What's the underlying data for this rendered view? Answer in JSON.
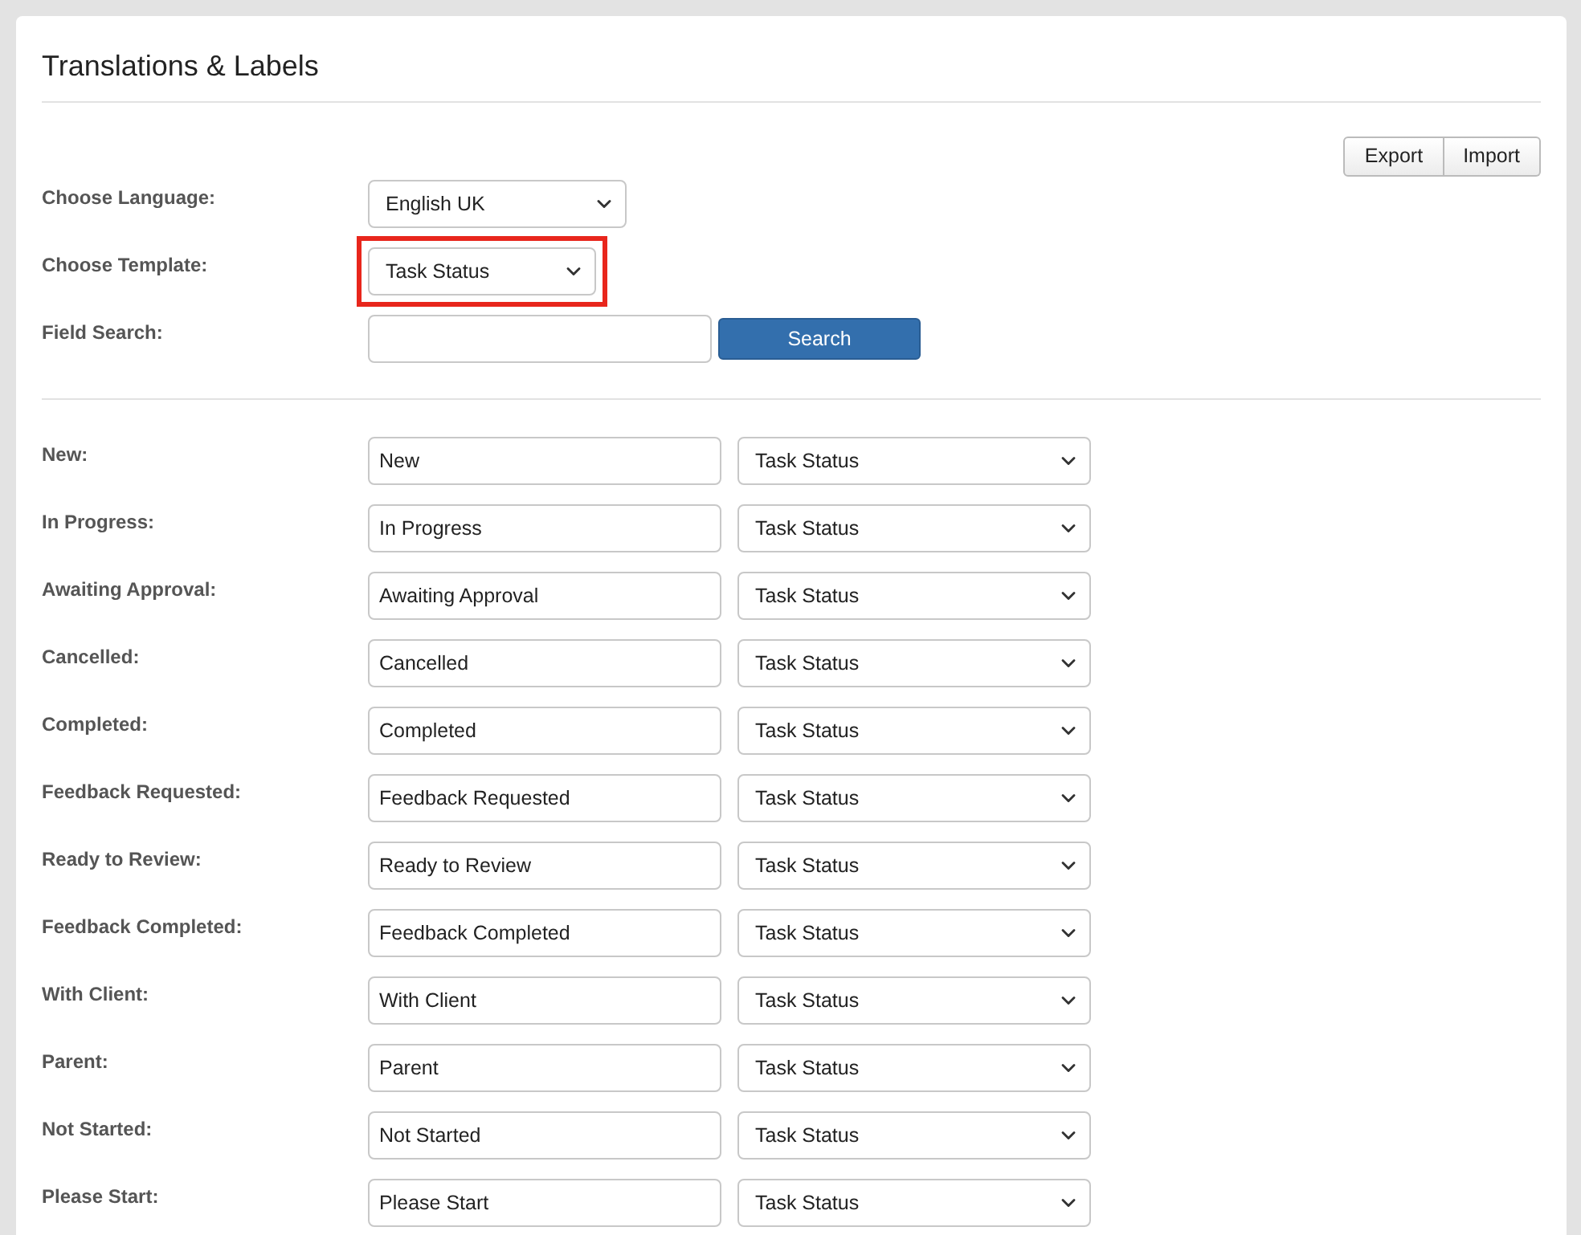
{
  "title": "Translations & Labels",
  "toolbar": [
    "Export",
    "Import"
  ],
  "settings": [
    {
      "kind": "select",
      "label": "Choose Language:",
      "value": "English UK",
      "highlighted": false
    },
    {
      "kind": "select",
      "label": "Choose Template:",
      "value": "Task Status",
      "highlighted": true
    },
    {
      "kind": "search",
      "label": "Field Search:",
      "button": "Search",
      "highlighted": false
    }
  ],
  "rows": [
    {
      "label": "New:",
      "value": "New",
      "template": "Task Status"
    },
    {
      "label": "In Progress:",
      "value": "In Progress",
      "template": "Task Status"
    },
    {
      "label": "Awaiting Approval:",
      "value": "Awaiting Approval",
      "template": "Task Status"
    },
    {
      "label": "Cancelled:",
      "value": "Cancelled",
      "template": "Task Status"
    },
    {
      "label": "Completed:",
      "value": "Completed",
      "template": "Task Status"
    },
    {
      "label": "Feedback Requested:",
      "value": "Feedback Requested",
      "template": "Task Status"
    },
    {
      "label": "Ready to Review:",
      "value": "Ready to Review",
      "template": "Task Status"
    },
    {
      "label": "Feedback Completed:",
      "value": "Feedback Completed",
      "template": "Task Status"
    },
    {
      "label": "With Client:",
      "value": "With Client",
      "template": "Task Status"
    },
    {
      "label": "Parent:",
      "value": "Parent",
      "template": "Task Status"
    },
    {
      "label": "Not Started:",
      "value": "Not Started",
      "template": "Task Status"
    },
    {
      "label": "Please Start:",
      "value": "Please Start",
      "template": "Task Status"
    }
  ]
}
